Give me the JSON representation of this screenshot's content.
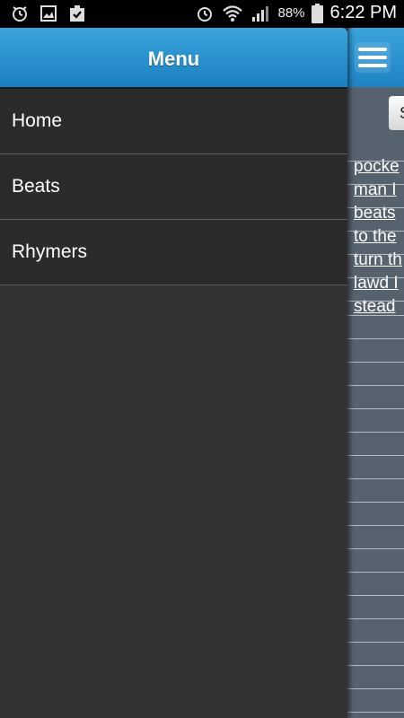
{
  "status_bar": {
    "icons_left": [
      "alarm-clock-icon",
      "image-icon",
      "task-check-icon"
    ],
    "icons_right": [
      "alarm-icon",
      "wifi-icon",
      "signal-icon",
      "battery-icon"
    ],
    "battery": "88%",
    "time": "6:22 PM"
  },
  "menu": {
    "title": "Menu",
    "items": [
      {
        "label": "Home"
      },
      {
        "label": "Beats"
      },
      {
        "label": "Rhymers"
      }
    ]
  },
  "main": {
    "button_label": "S",
    "lyrics": [
      "pocke",
      "man I",
      "beats",
      "to the",
      "turn th",
      "lawd I",
      "stead"
    ]
  },
  "colors": {
    "header_blue": "#2a95d2",
    "menu_background": "#333333",
    "panel_background": "#56626e"
  }
}
